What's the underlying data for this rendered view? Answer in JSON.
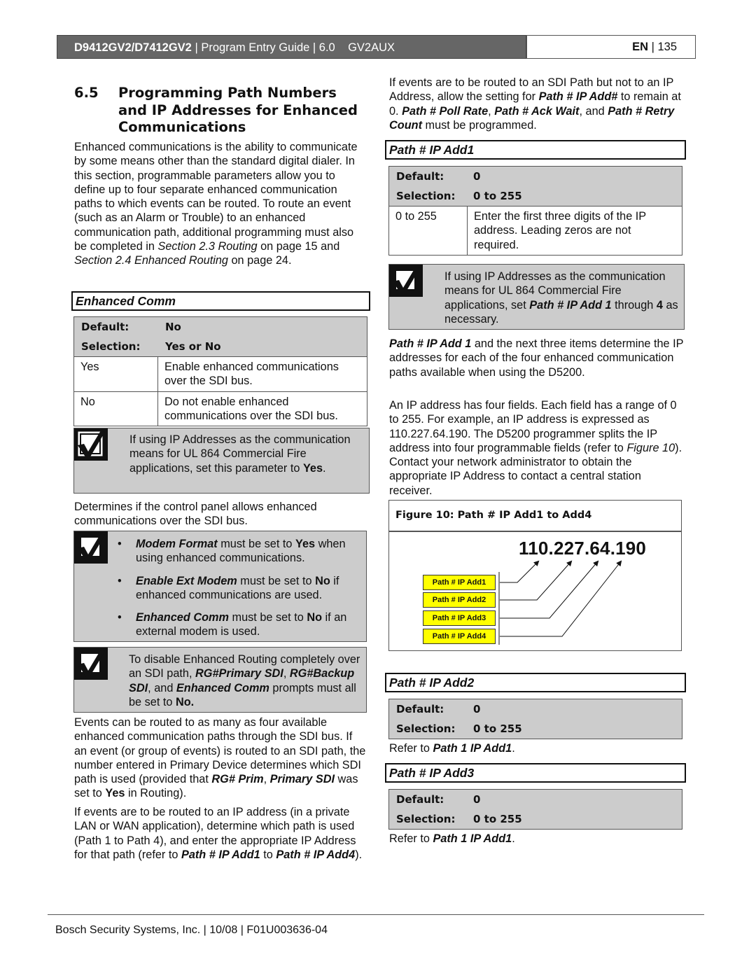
{
  "header": {
    "model": "D9412GV2/D7412GV2",
    "sep1": " | ",
    "guide": "Program Entry Guide",
    "sep2": " | ",
    "version": "6.0",
    "section_code": "GV2AUX",
    "lang": "EN",
    "sep3": " | ",
    "page": "135"
  },
  "section": {
    "number": "6.5",
    "title": "Programming Path Numbers and IP Addresses for Enhanced Communications",
    "intro": {
      "text1": "Enhanced communications is the ability to communicate by some means other than the standard digital dialer. In this section, programmable parameters allow you to define up to four separate enhanced communication paths to which events can be routed. To route an event (such as an Alarm or Trouble) to an enhanced communication path, additional programming must also be completed in ",
      "ref1": "Section 2.3 Routing",
      "text2": " on page 15 and ",
      "ref2": "Section 2.4 Enhanced Routing",
      "text3": " on page 24."
    }
  },
  "enhanced_comm": {
    "title": "Enhanced Comm",
    "default_label": "Default:",
    "default_value": "No",
    "selection_label": "Selection:",
    "selection_value": "Yes or No",
    "rows": [
      {
        "option": "Yes",
        "description": "Enable enhanced communications over the SDI bus."
      },
      {
        "option": "No",
        "description": "Do not enable enhanced communications over the SDI bus."
      }
    ],
    "note1": {
      "text": "If using IP Addresses as the communication means for UL 864 Commercial Fire applications, set this parameter to ",
      "bold": "Yes",
      "end": "."
    },
    "description": "Determines if the control panel allows enhanced communications over the SDI bus.",
    "note2": [
      {
        "bi": "Modem Format",
        "t1": " must be set to ",
        "b": "Yes",
        "t2": " when using enhanced communications."
      },
      {
        "bi": "Enable Ext Modem",
        "t1": " must be set to ",
        "b": "No",
        "t2": " if enhanced communications are used."
      },
      {
        "bi": "Enhanced Comm",
        "t1": " must be set to ",
        "b": "No",
        "t2": " if an external modem is used."
      }
    ],
    "note3": {
      "t1": "To disable Enhanced Routing completely over an SDI path, ",
      "bi1": "RG#Primary SDI",
      "t2": ", ",
      "bi2": "RG#Backup SDI",
      "t3": ", and ",
      "bi3": "Enhanced Comm",
      "t4": " prompts must all be set to ",
      "b": "No.",
      "t5": ""
    },
    "para1": {
      "t1": "Events can be routed to as many as four available enhanced communication paths through the SDI bus. If an event (or group of events) is routed to an SDI path, the number entered in Primary Device determines which SDI path is used (provided that ",
      "bi1": "RG# Prim",
      "t2": ", ",
      "bi2": "Primary SDI",
      "t3": " was set to ",
      "b": "Yes",
      "t4": " in Routing)."
    },
    "para2": {
      "t1": "If events are to be routed to an IP address (in a private LAN or WAN application), determine which path is used (Path 1 to Path 4), and enter the appropriate IP Address for that path (refer to ",
      "bi1": "Path # IP Add1",
      "t2": " to ",
      "bi2": "Path # IP Add4",
      "t3": ")."
    }
  },
  "right_intro": {
    "t1": "If events are to be routed to an SDI Path but not to an IP Address, allow the setting for ",
    "bi1": "Path # IP Add#",
    "t2": " to remain at 0. ",
    "bi2": "Path # Poll Rate",
    "t3": ", ",
    "bi3": "Path # Ack Wait",
    "t4": ", and ",
    "bi4": "Path # Retry Count",
    "t5": " must be programmed."
  },
  "ip_add1": {
    "title": "Path # IP Add1",
    "default_label": "Default:",
    "default_value": "0",
    "selection_label": "Selection:",
    "selection_value": "0 to 255",
    "rows": [
      {
        "option": "0 to 255",
        "description": "Enter the first three digits of the IP address. Leading zeros are not required."
      }
    ],
    "note": {
      "t1": "If using IP Addresses as the communication means for UL 864 Commercial Fire applications, set ",
      "bi1": "Path # IP Add 1",
      "t2": " through ",
      "b": "4",
      "t3": " as necessary."
    },
    "para1": {
      "bi": "Path # IP Add 1",
      "t": " and the next three items determine the IP addresses for each of the four enhanced communication paths available when using the D5200."
    },
    "para2": {
      "t1": "An IP address has  four fields. Each field has a range of 0 to 255. For example, an IP address is expressed as 110.227.64.190. The D5200 programmer splits the IP address into four programmable fields (refer to ",
      "i": "Figure 10",
      "t2": "). Contact your network administrator to obtain the appropriate IP Address to contact a central station receiver."
    }
  },
  "figure": {
    "caption": "Figure 10: Path # IP Add1 to Add4",
    "ip": "110.227.64.190",
    "labels": [
      "Path # IP Add1",
      "Path # IP Add2",
      "Path # IP Add3",
      "Path # IP Add4"
    ],
    "label_color": "#ffff00"
  },
  "ip_add2": {
    "title": "Path # IP Add2",
    "default_label": "Default:",
    "default_value": "0",
    "selection_label": "Selection:",
    "selection_value": "0 to 255",
    "refer_text": "Refer to ",
    "refer_bi": "Path 1 IP Add1",
    "refer_end": "."
  },
  "ip_add3": {
    "title": "Path # IP Add3",
    "default_label": "Default:",
    "default_value": "0",
    "selection_label": "Selection:",
    "selection_value": "0 to 255",
    "refer_text": "Refer to ",
    "refer_bi": "Path 1 IP Add1",
    "refer_end": "."
  },
  "footer": {
    "company": "Bosch Security Systems, Inc.",
    "sep1": " | ",
    "date": "10/08",
    "sep2": " | ",
    "doc_number": "F01U003636-04"
  }
}
